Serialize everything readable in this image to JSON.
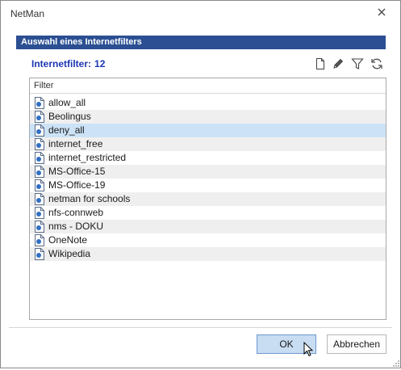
{
  "window": {
    "title": "NetMan"
  },
  "section": {
    "title": "Auswahl eines Internetfilters"
  },
  "count": {
    "label": "Internetfilter:",
    "value": "12"
  },
  "toolbar": {
    "icons": [
      "new-document-icon",
      "edit-pencil-icon",
      "filter-funnel-icon",
      "refresh-icon"
    ]
  },
  "list": {
    "header": "Filter",
    "selected_index": 2,
    "items": [
      {
        "label": "allow_all"
      },
      {
        "label": "Beolingus"
      },
      {
        "label": "deny_all"
      },
      {
        "label": "internet_free"
      },
      {
        "label": "internet_restricted"
      },
      {
        "label": "MS-Office-15"
      },
      {
        "label": "MS-Office-19"
      },
      {
        "label": "netman for schools"
      },
      {
        "label": "nfs-connweb"
      },
      {
        "label": "nms - DOKU"
      },
      {
        "label": "OneNote"
      },
      {
        "label": "Wikipedia"
      }
    ]
  },
  "buttons": {
    "ok": "OK",
    "cancel": "Abbrechen"
  },
  "colors": {
    "section_header_bg": "#2b4f92",
    "count_label": "#1d36b4",
    "selected_row": "#cce3f7",
    "alt_row": "#efefef"
  }
}
